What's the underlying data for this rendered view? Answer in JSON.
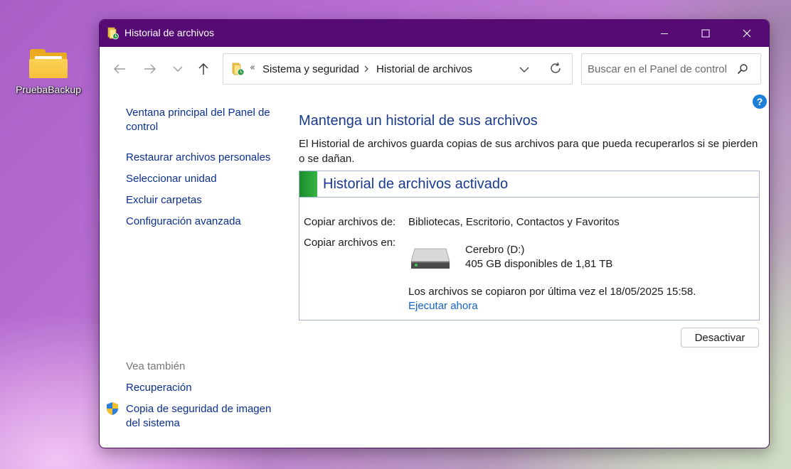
{
  "desktop": {
    "icon_label": "PruebaBackup",
    "icon": "folder-icon"
  },
  "window": {
    "title": "Historial de archivos",
    "controls": [
      "minimize-icon",
      "maximize-icon",
      "close-icon"
    ]
  },
  "nav": {
    "breadcrumb_prefix": "«",
    "breadcrumb": [
      "Sistema y seguridad",
      "Historial de archivos"
    ],
    "search_placeholder": "Buscar en el Panel de control"
  },
  "help_label": "?",
  "sidebar": {
    "links": [
      "Ventana principal del Panel de control",
      "Restaurar archivos personales",
      "Seleccionar unidad",
      "Excluir carpetas",
      "Configuración avanzada"
    ],
    "see_also_label": "Vea también",
    "see_also": [
      "Recuperación",
      "Copia de seguridad de imagen del sistema"
    ]
  },
  "main": {
    "title": "Mantenga un historial de sus archivos",
    "description": "El Historial de archivos guarda copias de sus archivos para que pueda recuperarlos si se pierden o se dañan.",
    "status": {
      "title": "Historial de archivos activado",
      "status_color": "#2ea83c",
      "copy_from_label": "Copiar archivos de:",
      "copy_from_value": "Bibliotecas, Escritorio, Contactos y Favoritos",
      "copy_to_label": "Copiar archivos en:",
      "drive_name": "Cerebro (D:)",
      "drive_space": "405 GB disponibles de 1,81 TB",
      "last_copy": "Los archivos se copiaron por última vez el 18/05/2025 15:58.",
      "run_now": "Ejecutar ahora"
    },
    "deactivate_button": "Desactivar"
  },
  "colors": {
    "titlebar": "#560a74",
    "link": "#0b2f8f",
    "heading": "#1a3a8f"
  }
}
